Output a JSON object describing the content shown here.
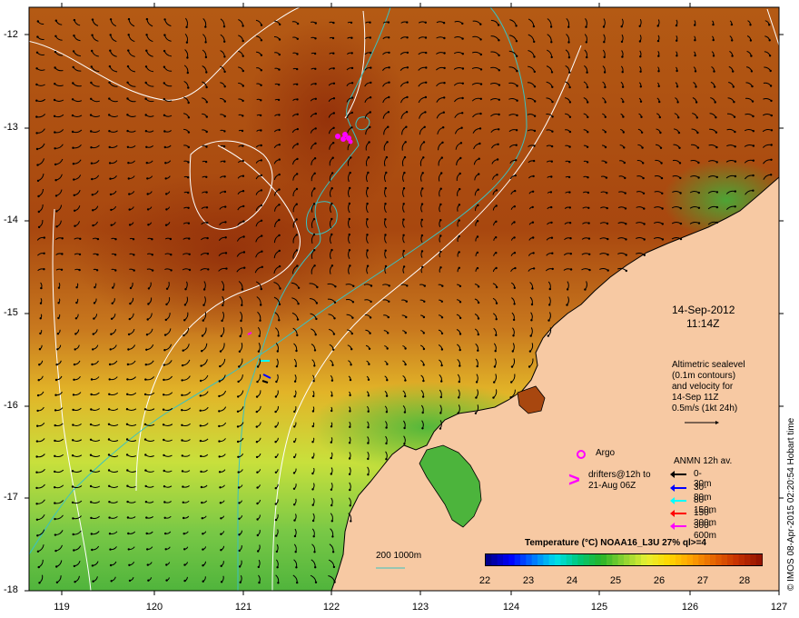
{
  "map": {
    "lon_ticks": [
      "119",
      "120",
      "121",
      "122",
      "123",
      "124",
      "125",
      "126",
      "127"
    ],
    "lat_ticks": [
      "-12",
      "-13",
      "-14",
      "-15",
      "-16",
      "-17",
      "-18"
    ],
    "extent": {
      "lon_min": 118.6,
      "lon_max": 127.0,
      "lat_min": -18.0,
      "lat_max": -11.8
    },
    "colors": {
      "land": "#f7c9a3",
      "coastline": "#000000",
      "sealevel_contour": "#ffffff",
      "bathymetry_contour": "#39c2c2",
      "argo_marker": "#ff00ff",
      "velocity_arrow": "#000000"
    }
  },
  "date_label": {
    "date": "14-Sep-2012",
    "time": "11:14Z"
  },
  "altimetry_note": [
    "Altimetric sealevel",
    "(0.1m contours)",
    "and velocity for",
    "14-Sep 11Z",
    "0.5m/s (1kt 24h)"
  ],
  "argo": {
    "label": "Argo"
  },
  "drifters": {
    "marker": ">",
    "line1": "drifters@12h to",
    "line2": "21-Aug 06Z"
  },
  "anmn": {
    "title": "ANMN 12h av.",
    "items": [
      {
        "label": "0-30m",
        "color": "#000000"
      },
      {
        "label": "30-80m",
        "color": "#0000ff"
      },
      {
        "label": "80-150m",
        "color": "#00ffff"
      },
      {
        "label": "150-300m",
        "color": "#ff0000"
      },
      {
        "label": "300-600m",
        "color": "#ff00ff"
      }
    ]
  },
  "bathy_legend": {
    "label": "200  1000m"
  },
  "colorbar": {
    "title": "Temperature (°C) NOAA16_L3U 27% ql>=4",
    "ticks": [
      "22",
      "23",
      "24",
      "25",
      "26",
      "27",
      "28"
    ],
    "range": [
      22,
      28.4
    ],
    "stops": [
      "#00008c",
      "#0000ff",
      "#0078ff",
      "#00e0e8",
      "#00c878",
      "#28b428",
      "#8cd232",
      "#e6f032",
      "#ffd700",
      "#ffa000",
      "#e66400",
      "#c83200",
      "#961400"
    ]
  },
  "credit": "© IMOS 08-Apr-2015 02:20:54 Hobart time"
}
